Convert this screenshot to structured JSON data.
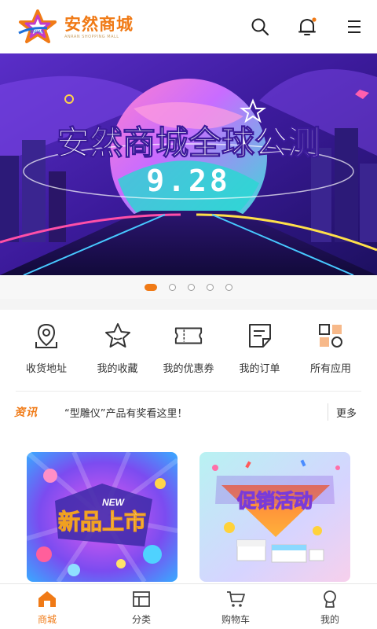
{
  "header": {
    "logo_title": "安然商城",
    "logo_sub": "ANRAN SHOPPING MALL",
    "icons": [
      "search-icon",
      "bell-icon",
      "menu-icon"
    ]
  },
  "banner": {
    "headline": "安然商城全球公测",
    "date": "9.28",
    "slide_count": 5,
    "active_slide": 1
  },
  "quick_menu": [
    {
      "label": "收货地址",
      "icon": "location-pin-icon"
    },
    {
      "label": "我的收藏",
      "icon": "star-icon"
    },
    {
      "label": "我的优惠券",
      "icon": "coupon-icon"
    },
    {
      "label": "我的订单",
      "icon": "order-icon"
    },
    {
      "label": "所有应用",
      "icon": "apps-icon"
    }
  ],
  "news": {
    "tag": "资讯",
    "text": "“型雕仪”产品有奖看这里！",
    "more": "更多"
  },
  "promos": [
    {
      "title": "新品上市",
      "badge": "NEW"
    },
    {
      "title": "促销活动"
    }
  ],
  "bottom_nav": [
    {
      "label": "商城",
      "icon": "home-icon",
      "active": true
    },
    {
      "label": "分类",
      "icon": "category-icon",
      "active": false
    },
    {
      "label": "购物车",
      "icon": "cart-icon",
      "active": false
    },
    {
      "label": "我的",
      "icon": "profile-icon",
      "active": false
    }
  ],
  "colors": {
    "accent": "#f07a16",
    "banner_bg": "#3a1d8f",
    "notification_dot": "#f07a16"
  }
}
